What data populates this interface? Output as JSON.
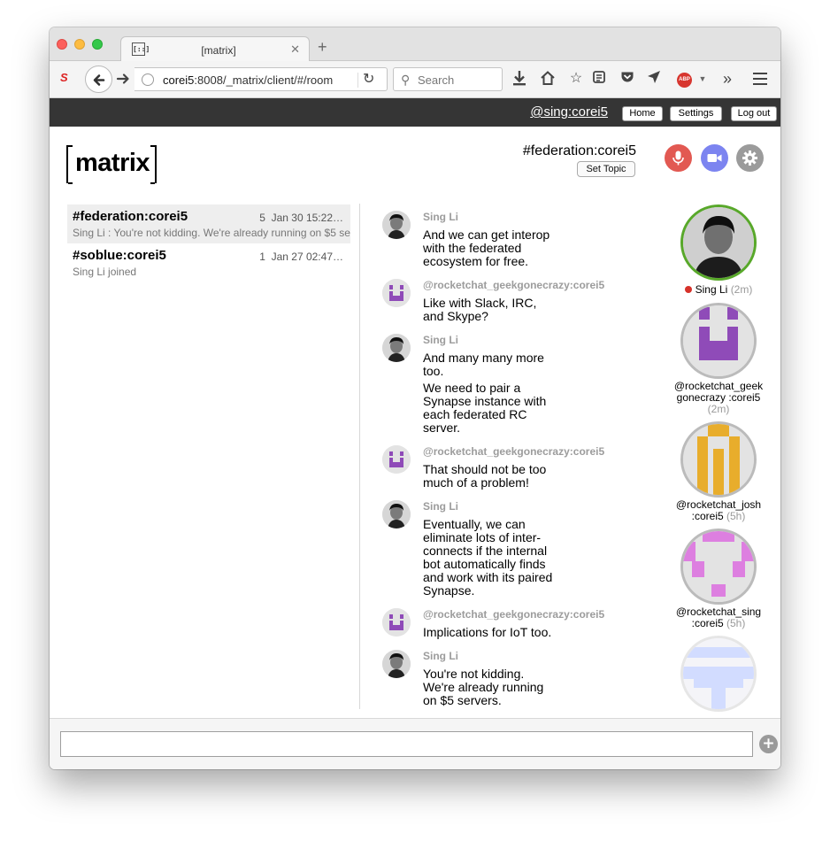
{
  "browser": {
    "tab_title": "[matrix]",
    "tab_icon_glyph": "[::]",
    "url_host": "corei5",
    "url_rest": ":8008/_matrix/client/#/room",
    "search_placeholder": "Search",
    "abp_label": "ABP",
    "extension_label": "S"
  },
  "header": {
    "user_id": "@sing:corei5",
    "home_label": "Home",
    "settings_label": "Settings",
    "logout_label": "Log out"
  },
  "logo_text": "matrix",
  "room": {
    "name": "#federation:corei5",
    "set_topic_label": "Set Topic"
  },
  "colors": {
    "voice_call": "#e25952",
    "video_call": "#7c84f0",
    "settings": "#9b9b9b",
    "online_ring": "#58a82a",
    "presence_dot": "#d6322a"
  },
  "room_list": [
    {
      "name": "#federation:corei5",
      "count": "5",
      "time": "Jan 30 15:22…",
      "last_message": "Sing Li : You're not kidding. We're already running on $5 se"
    },
    {
      "name": "#soblue:corei5",
      "count": "1",
      "time": "Jan 27 02:47…",
      "last_message": "Sing Li joined"
    }
  ],
  "messages": [
    {
      "sender": "Sing Li",
      "avatar": "photo-avatar",
      "text": "And we can get interop with the federated ecosystem for free.",
      "text2": ""
    },
    {
      "sender": "@rocketchat_geekgonecrazy:corei5",
      "avatar": "identicon-purple",
      "text": "Like with Slack, IRC, and Skype?",
      "text2": ""
    },
    {
      "sender": "Sing Li",
      "avatar": "photo-avatar",
      "text": "And many many more too.",
      "text2": "We need to pair a Synapse instance with each federated RC server."
    },
    {
      "sender": "@rocketchat_geekgonecrazy:corei5",
      "avatar": "identicon-purple",
      "text": "That should not be too much of a problem!",
      "text2": ""
    },
    {
      "sender": "Sing Li",
      "avatar": "photo-avatar",
      "text": "Eventually, we can eliminate lots of inter-connects if the internal bot automatically finds and work with its paired Synapse.",
      "text2": ""
    },
    {
      "sender": "@rocketchat_geekgonecrazy:corei5",
      "avatar": "identicon-purple",
      "text": "Implications for IoT too.",
      "text2": ""
    },
    {
      "sender": "Sing Li",
      "avatar": "photo-avatar",
      "text": "You're not kidding. We're already running on $5 servers.",
      "text2": ""
    }
  ],
  "members": [
    {
      "name": "Sing Li",
      "time": "(2m)"
    },
    {
      "name": "@rocketchat_geek gonecrazy :corei5",
      "time": "(2m)"
    },
    {
      "name": "@rocketchat_josh :corei5",
      "time": "(5h)"
    },
    {
      "name": "@rocketchat_sing :corei5",
      "time": "(5h)"
    },
    {
      "name": "",
      "time": ""
    }
  ]
}
